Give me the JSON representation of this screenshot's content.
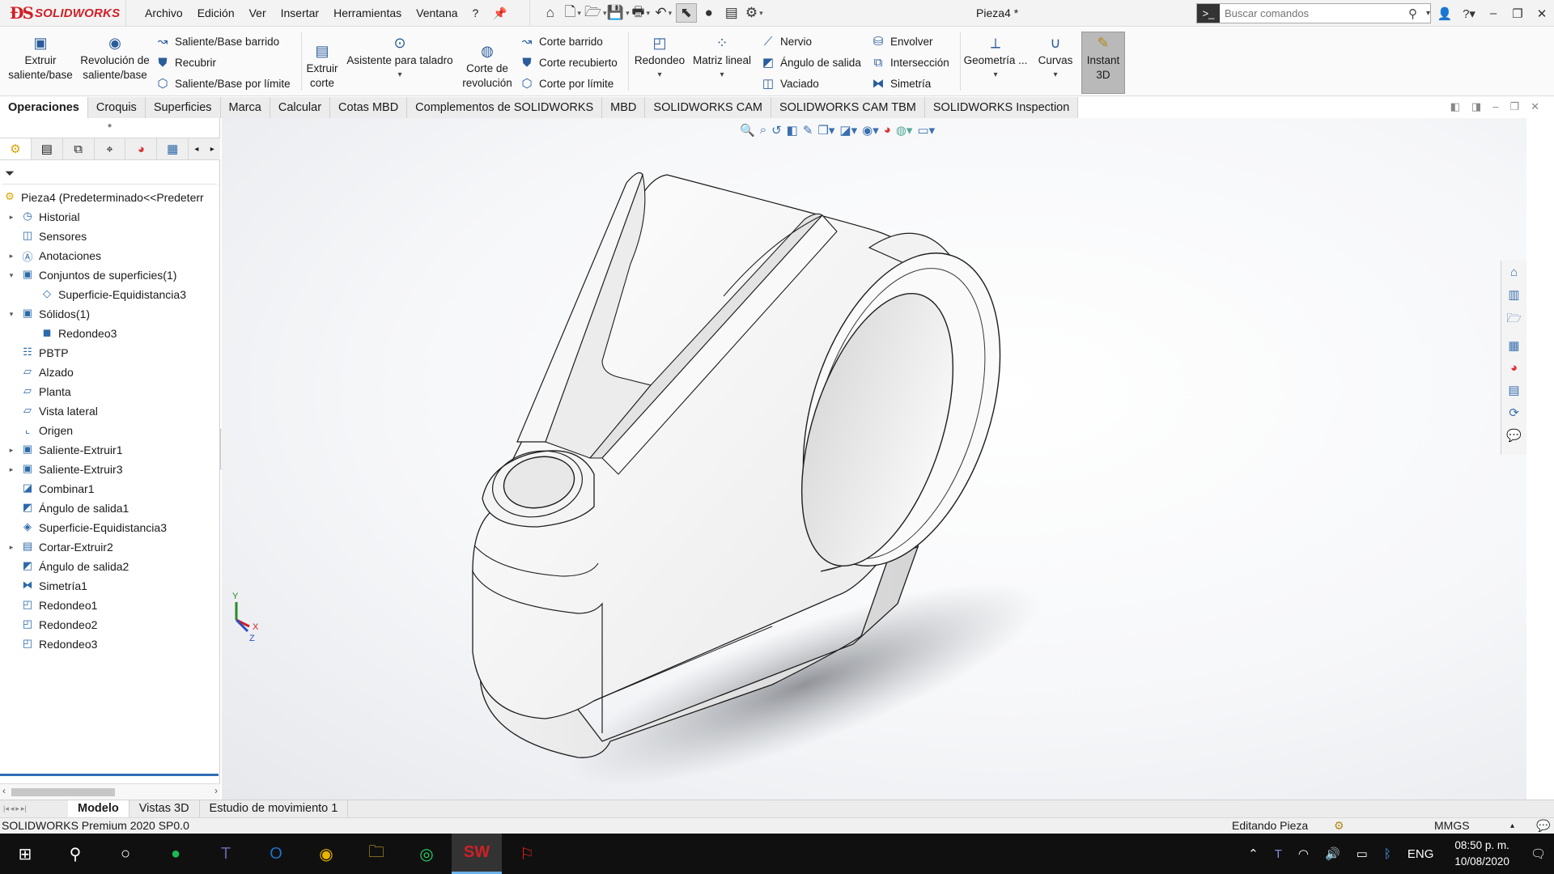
{
  "app": {
    "brand": "SOLIDWORKS",
    "document_title": "Pieza4 *",
    "search_placeholder": "Buscar comandos"
  },
  "menu": [
    "Archivo",
    "Edición",
    "Ver",
    "Insertar",
    "Herramientas",
    "Ventana",
    "?"
  ],
  "ribbon": {
    "extruir": "Extruir saliente/base",
    "revolucion": "Revolución de saliente/base",
    "saliente_barrido": "Saliente/Base barrido",
    "recubrir": "Recubrir",
    "saliente_limite": "Saliente/Base por límite",
    "extruir_corte": "Extruir corte",
    "asistente_taladro": "Asistente para taladro",
    "corte_revolucion": "Corte de revolución",
    "corte_barrido": "Corte barrido",
    "corte_recubierto": "Corte recubierto",
    "corte_limite": "Corte por límite",
    "redondeo": "Redondeo",
    "matriz_lineal": "Matriz lineal",
    "nervio": "Nervio",
    "angulo_salida": "Ángulo de salida",
    "vaciado": "Vaciado",
    "envolver": "Envolver",
    "interseccion": "Intersección",
    "simetria": "Simetría",
    "geometria": "Geometría ...",
    "curvas": "Curvas",
    "instant3d": "Instant 3D"
  },
  "command_tabs": [
    "Operaciones",
    "Croquis",
    "Superficies",
    "Marca",
    "Calcular",
    "Cotas MBD",
    "Complementos de SOLIDWORKS",
    "MBD",
    "SOLIDWORKS CAM",
    "SOLIDWORKS CAM TBM",
    "SOLIDWORKS Inspection"
  ],
  "feature_tree": {
    "root": "Pieza4  (Predeterminado<<Predeterr",
    "items": [
      {
        "label": "Historial",
        "icon": "history-icon",
        "expandable": true,
        "level": 1
      },
      {
        "label": "Sensores",
        "icon": "sensor-icon",
        "expandable": false,
        "level": 1
      },
      {
        "label": "Anotaciones",
        "icon": "annotation-icon",
        "expandable": true,
        "level": 1
      },
      {
        "label": "Conjuntos de superficies(1)",
        "icon": "surface-folder-icon",
        "expandable": true,
        "expanded": true,
        "level": 1
      },
      {
        "label": "Superficie-Equidistancia3",
        "icon": "surface-icon",
        "expandable": false,
        "level": 2
      },
      {
        "label": "Sólidos(1)",
        "icon": "solid-folder-icon",
        "expandable": true,
        "expanded": true,
        "level": 1
      },
      {
        "label": "Redondeo3",
        "icon": "solid-body-icon",
        "expandable": false,
        "level": 2
      },
      {
        "label": "PBTP",
        "icon": "material-icon",
        "expandable": false,
        "level": 1
      },
      {
        "label": "Alzado",
        "icon": "plane-icon",
        "expandable": false,
        "level": 1
      },
      {
        "label": "Planta",
        "icon": "plane-icon",
        "expandable": false,
        "level": 1
      },
      {
        "label": "Vista lateral",
        "icon": "plane-icon",
        "expandable": false,
        "level": 1
      },
      {
        "label": "Origen",
        "icon": "origin-icon",
        "expandable": false,
        "level": 1
      },
      {
        "label": "Saliente-Extruir1",
        "icon": "extrude-icon",
        "expandable": true,
        "level": 1
      },
      {
        "label": "Saliente-Extruir3",
        "icon": "extrude-icon",
        "expandable": true,
        "level": 1
      },
      {
        "label": "Combinar1",
        "icon": "combine-icon",
        "expandable": false,
        "level": 1
      },
      {
        "label": "Ángulo de salida1",
        "icon": "draft-icon",
        "expandable": false,
        "level": 1
      },
      {
        "label": "Superficie-Equidistancia3",
        "icon": "offset-surface-icon",
        "expandable": false,
        "level": 1
      },
      {
        "label": "Cortar-Extruir2",
        "icon": "cut-extrude-icon",
        "expandable": true,
        "level": 1
      },
      {
        "label": "Ángulo de salida2",
        "icon": "draft-icon",
        "expandable": false,
        "level": 1
      },
      {
        "label": "Simetría1",
        "icon": "mirror-icon",
        "expandable": false,
        "level": 1
      },
      {
        "label": "Redondeo1",
        "icon": "fillet-icon",
        "expandable": false,
        "level": 1
      },
      {
        "label": "Redondeo2",
        "icon": "fillet-icon",
        "expandable": false,
        "level": 1
      },
      {
        "label": "Redondeo3",
        "icon": "fillet-icon",
        "expandable": false,
        "level": 1
      }
    ]
  },
  "bottom_tabs": [
    "Modelo",
    "Vistas 3D",
    "Estudio de movimiento 1"
  ],
  "status": {
    "product": "SOLIDWORKS Premium 2020 SP0.0",
    "mode": "Editando Pieza",
    "units": "MMGS"
  },
  "triad": {
    "x": "X",
    "y": "Y",
    "z": "Z"
  },
  "taskbar": {
    "language": "ENG",
    "time": "08:50 p. m.",
    "date": "10/08/2020"
  }
}
